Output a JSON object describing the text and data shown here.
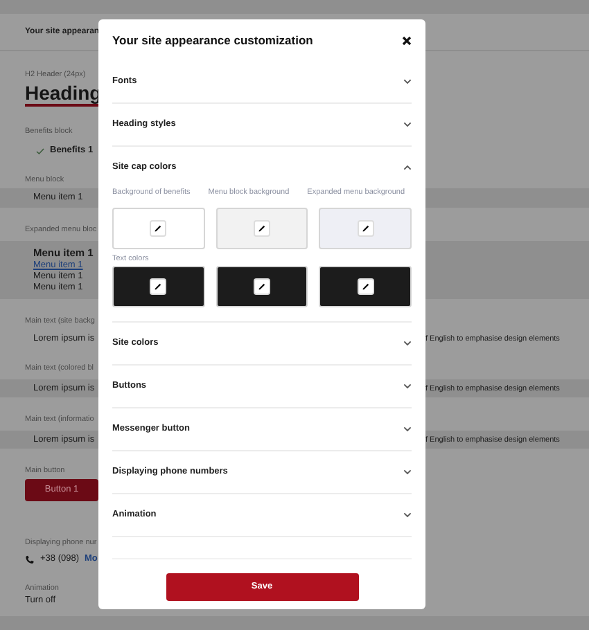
{
  "background_page": {
    "title": "Your site appearan",
    "items": [
      {
        "kind": "label",
        "text": "H2 Header (24px)"
      },
      {
        "kind": "heading",
        "text": "Heading"
      },
      {
        "kind": "label",
        "text": "Benefits block"
      },
      {
        "kind": "benefit",
        "text": "Benefits 1"
      },
      {
        "kind": "label",
        "text": "Menu block"
      },
      {
        "kind": "menu_box",
        "text": "Menu item 1"
      },
      {
        "kind": "label",
        "text": "Expanded menu bloc"
      },
      {
        "kind": "expanded_menu",
        "entries": [
          {
            "kind": "title",
            "text": "Menu item 1"
          },
          {
            "kind": "link",
            "text": "Menu item 1"
          },
          {
            "kind": "plain",
            "text": "Menu item 1"
          },
          {
            "kind": "plain",
            "text": "Menu item 1"
          }
        ]
      },
      {
        "kind": "label",
        "text": "Main text (site backg"
      },
      {
        "kind": "text",
        "text": "Lorem ipsum is",
        "right_text": "f English to emphasise design elements"
      },
      {
        "kind": "label",
        "text": "Main text (colored bl"
      },
      {
        "kind": "text_box",
        "text": "Lorem ipsum is",
        "right_text": "f English to emphasise design elements"
      },
      {
        "kind": "label",
        "text": "Main text (informatio"
      },
      {
        "kind": "text_box",
        "text": "Lorem ipsum is",
        "right_text": "f English to emphasise design elements"
      },
      {
        "kind": "label",
        "text": "Main button"
      },
      {
        "kind": "button",
        "text": "Button 1"
      },
      {
        "kind": "label",
        "text": "Displaying phone nur"
      },
      {
        "kind": "phone",
        "text": "+38 (098)",
        "link": "Mo"
      },
      {
        "kind": "label",
        "text": "Animation"
      },
      {
        "kind": "value",
        "text": "Turn off"
      }
    ]
  },
  "modal": {
    "title": "Your site appearance customization",
    "sections": [
      {
        "title": "Fonts",
        "expanded": false
      },
      {
        "title": "Heading styles",
        "expanded": false
      },
      {
        "title": "Site cap colors",
        "expanded": true,
        "groups": [
          {
            "swatches": [
              {
                "label": "Background of benefits",
                "color": "#ffffff"
              },
              {
                "label": "Menu block background",
                "color": "#f2f2f2"
              },
              {
                "label": "Expanded menu background",
                "color": "#eeeff5"
              }
            ]
          },
          {
            "label": "Text colors",
            "swatches": [
              {
                "color": "#1c1c1c"
              },
              {
                "color": "#1c1c1c"
              },
              {
                "color": "#1c1c1c"
              }
            ]
          }
        ]
      },
      {
        "title": "Site colors",
        "expanded": false
      },
      {
        "title": "Buttons",
        "expanded": false
      },
      {
        "title": "Messenger button",
        "expanded": false
      },
      {
        "title": "Displaying phone numbers",
        "expanded": false
      },
      {
        "title": "Animation",
        "expanded": false
      }
    ],
    "save_button": "Save"
  }
}
